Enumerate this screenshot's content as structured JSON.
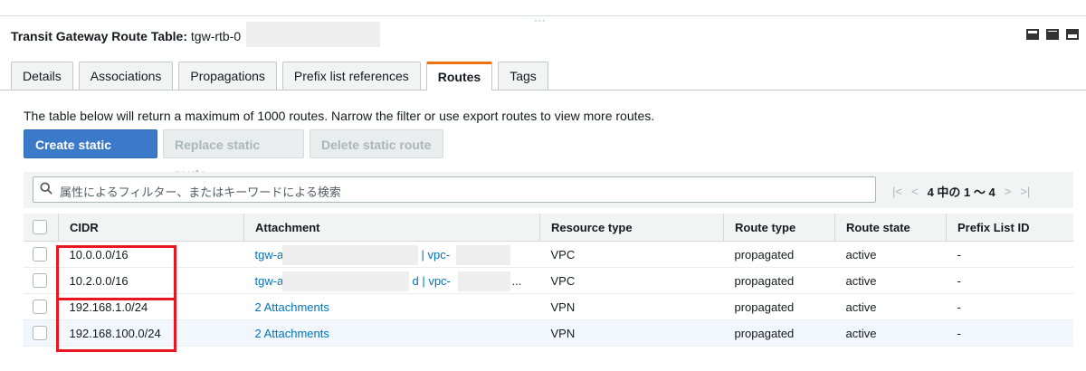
{
  "panel": {
    "title_label": "Transit Gateway Route Table:",
    "title_value": "tgw-rtb-0",
    "drag_handle": "◦◦◦",
    "layout_icons": [
      "layout-bottom-icon",
      "layout-half-icon",
      "layout-top-icon"
    ]
  },
  "tabs": [
    {
      "label": "Details",
      "active": false
    },
    {
      "label": "Associations",
      "active": false
    },
    {
      "label": "Propagations",
      "active": false
    },
    {
      "label": "Prefix list references",
      "active": false
    },
    {
      "label": "Routes",
      "active": true
    },
    {
      "label": "Tags",
      "active": false
    }
  ],
  "info_text": "The table below will return a maximum of 1000 routes. Narrow the filter or use export routes to view more routes.",
  "buttons": {
    "create": "Create static route",
    "replace": "Replace static route",
    "delete": "Delete static route"
  },
  "filter": {
    "placeholder": "属性によるフィルター、またはキーワードによる検索",
    "pagination": "4 中の 1 〜 4",
    "icons": [
      "first-page-icon",
      "prev-page-icon",
      "next-page-icon",
      "last-page-icon"
    ]
  },
  "table": {
    "headers": [
      "CIDR",
      "Attachment",
      "Resource type",
      "Route type",
      "Route state",
      "Prefix List ID"
    ],
    "rows": [
      {
        "cidr": "10.0.0.0/16",
        "attach_a": "tgw-a",
        "attach_b": "| vpc-",
        "attach_c": "",
        "resource": "VPC",
        "route_type": "propagated",
        "state": "active",
        "prefix": "-"
      },
      {
        "cidr": "10.2.0.0/16",
        "attach_a": "tgw-a",
        "attach_b": "d | vpc-",
        "attach_c": "...",
        "resource": "VPC",
        "route_type": "propagated",
        "state": "active",
        "prefix": "-"
      },
      {
        "cidr": "192.168.1.0/24",
        "attach_a": "2 Attachments",
        "attach_b": "",
        "attach_c": "",
        "resource": "VPN",
        "route_type": "propagated",
        "state": "active",
        "prefix": "-"
      },
      {
        "cidr": "192.168.100.0/24",
        "attach_a": "2 Attachments",
        "attach_b": "",
        "attach_c": "",
        "resource": "VPN",
        "route_type": "propagated",
        "state": "active",
        "prefix": "-"
      }
    ]
  },
  "colors": {
    "primary_button": "#3b7ac8",
    "active_tab_accent": "#ec7211",
    "link": "#0073bb",
    "highlight_box": "#e8161f"
  }
}
